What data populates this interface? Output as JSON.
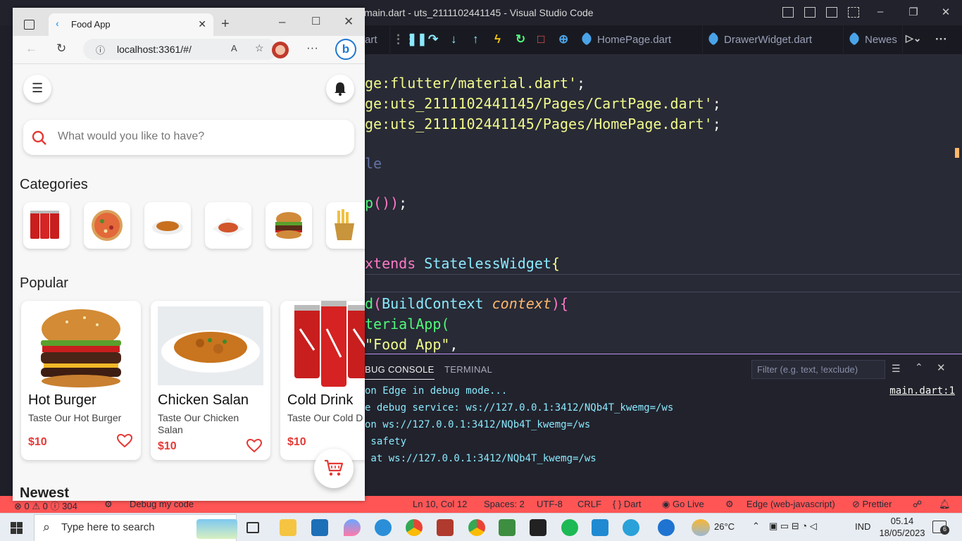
{
  "vscode": {
    "window_title": "main.dart - uts_2111102441145 - Visual Studio Code",
    "tabs": [
      "art",
      "HomePage.dart",
      "DrawerWidget.dart",
      "Newes"
    ],
    "code_lines": [
      {
        "parts": [
          {
            "t": "ge:flutter/material.dart'",
            "c": "#f1fa8c"
          },
          {
            "t": ";",
            "c": "#f8f8f2"
          }
        ]
      },
      {
        "parts": [
          {
            "t": "ge:uts_2111102441145/Pages/CartPage.dart'",
            "c": "#f1fa8c"
          },
          {
            "t": ";",
            "c": "#f8f8f2"
          }
        ]
      },
      {
        "parts": [
          {
            "t": "ge:uts_2111102441145/Pages/HomePage.dart'",
            "c": "#f1fa8c"
          },
          {
            "t": ";",
            "c": "#f8f8f2"
          }
        ]
      },
      {
        "parts": [
          {
            "t": "le",
            "c": "#6272a4"
          }
        ]
      },
      {
        "parts": [
          {
            "t": "p",
            "c": "#50fa7b"
          },
          {
            "t": "())",
            "c": "#ff79c6"
          },
          {
            "t": ";",
            "c": "#f8f8f2"
          }
        ]
      },
      {
        "parts": [
          {
            "t": "xtends ",
            "c": "#ff79c6"
          },
          {
            "t": "StatelessWidget",
            "c": "#8be9fd"
          },
          {
            "t": "{",
            "c": "#f1fa8c"
          }
        ]
      },
      {
        "parts": [
          {
            "t": "d",
            "c": "#50fa7b"
          },
          {
            "t": "(",
            "c": "#ff79c6"
          },
          {
            "t": "BuildContext ",
            "c": "#8be9fd"
          },
          {
            "t": "context",
            "c": "#ffb86c"
          },
          {
            "t": "){",
            "c": "#ff79c6"
          }
        ]
      },
      {
        "parts": [
          {
            "t": "terialApp(",
            "c": "#50fa7b"
          }
        ]
      },
      {
        "parts": [
          {
            "t": "\"Food App\"",
            "c": "#f1fa8c"
          },
          {
            "t": ",",
            "c": "#f8f8f2"
          }
        ]
      }
    ],
    "panel_tabs": {
      "debug_console": "BUG CONSOLE",
      "terminal": "TERMINAL"
    },
    "filter_placeholder": "Filter (e.g. text, !exclude)",
    "console_lines": [
      "on Edge in debug mode...",
      "e debug service: ws://127.0.0.1:3412/NQb4T_kwemg=/ws",
      "on ws://127.0.0.1:3412/NQb4T_kwemg=/ws",
      " safety",
      " at ws://127.0.0.1:3412/NQb4T_kwemg=/ws"
    ],
    "console_link": "main.dart:1",
    "status": {
      "problems": "0",
      "warnings": "0",
      "info": "304",
      "debug": "Debug my code",
      "position": "Ln 10, Col 12",
      "spaces": "Spaces: 2",
      "encoding": "UTF-8",
      "eol": "CRLF",
      "language": "Dart",
      "golive": "Go Live",
      "device": "Edge (web-javascript)",
      "prettier": "Prettier"
    }
  },
  "edge": {
    "tab_title": "Food App",
    "url": "localhost:3361/#/"
  },
  "app": {
    "search_placeholder": "What would you like to have?",
    "categories_title": "Categories",
    "categories": [
      "drink-cans",
      "pizza",
      "curry-plate",
      "fried-dish",
      "burger",
      "fries"
    ],
    "popular_title": "Popular",
    "popular": [
      {
        "title": "Hot Burger",
        "subtitle": "Taste Our Hot Burger",
        "price": "$10",
        "image": "burger"
      },
      {
        "title": "Chicken Salan",
        "subtitle": "Taste Our Chicken Salan",
        "price": "$10",
        "image": "curry"
      },
      {
        "title": "Cold Drink",
        "subtitle": "Taste Our Cold D",
        "price": "$10",
        "image": "cans"
      }
    ],
    "newest_title": "Newest"
  },
  "taskbar": {
    "search_placeholder": "Type here to search",
    "weather": "26°C",
    "language": "IND",
    "time": "05.14",
    "date": "18/05/2023",
    "notifications": "6"
  }
}
